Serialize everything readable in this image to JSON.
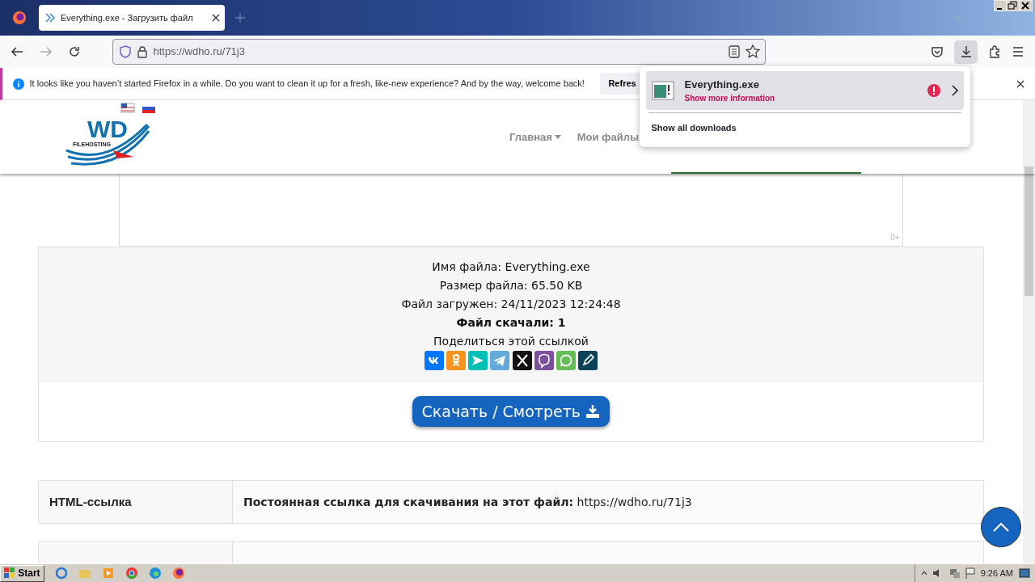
{
  "browser": {
    "tab_title": "Everything.exe - Загрузить файл",
    "url": "https://wdho.ru/71j3"
  },
  "notification": {
    "text": "It looks like you haven’t started Firefox in a while. Do you want to clean it up for a fresh, like-new experience? And by the way, welcome back!",
    "button": "Refres"
  },
  "downloads_panel": {
    "file": "Everything.exe",
    "status": "Show more information",
    "footer": "Show all downloads"
  },
  "site": {
    "logo": {
      "title": "WD",
      "subtitle": "FILEHOSTING"
    },
    "nav": [
      {
        "label": "Главная",
        "dropdown": true
      },
      {
        "label": "Мои файлы",
        "dropdown": false
      }
    ],
    "ad_label": "0+",
    "file_info": [
      {
        "text": "Имя файла: Everything.exe",
        "bold": false
      },
      {
        "text": "Размер файла: 65.50 KB",
        "bold": false
      },
      {
        "text": "Файл загружен: 24/11/2023 12:24:48",
        "bold": false
      },
      {
        "text": "Файл скачали: 1",
        "bold": true
      }
    ],
    "share_label": "Поделиться этой ссылкой",
    "share_buttons": [
      {
        "kind": "vk",
        "color": "#0077ff"
      },
      {
        "kind": "ok",
        "color": "#f7931e"
      },
      {
        "kind": "send",
        "color": "#00bfb3"
      },
      {
        "kind": "telegram",
        "color": "#64a9dc"
      },
      {
        "kind": "x",
        "color": "#111111"
      },
      {
        "kind": "viber",
        "color": "#7b519d"
      },
      {
        "kind": "whatsapp",
        "color": "#65bc54"
      },
      {
        "kind": "pen",
        "color": "#0d425a"
      }
    ],
    "download_button": "Скачать / Смотреть",
    "links": [
      {
        "label": "HTML-ссылка",
        "value": "**Постоянная ссылка для скачивания на этот файл:** https://wdho.ru/71j3"
      }
    ]
  },
  "taskbar": {
    "start": "Start",
    "time": "9:26 AM"
  }
}
